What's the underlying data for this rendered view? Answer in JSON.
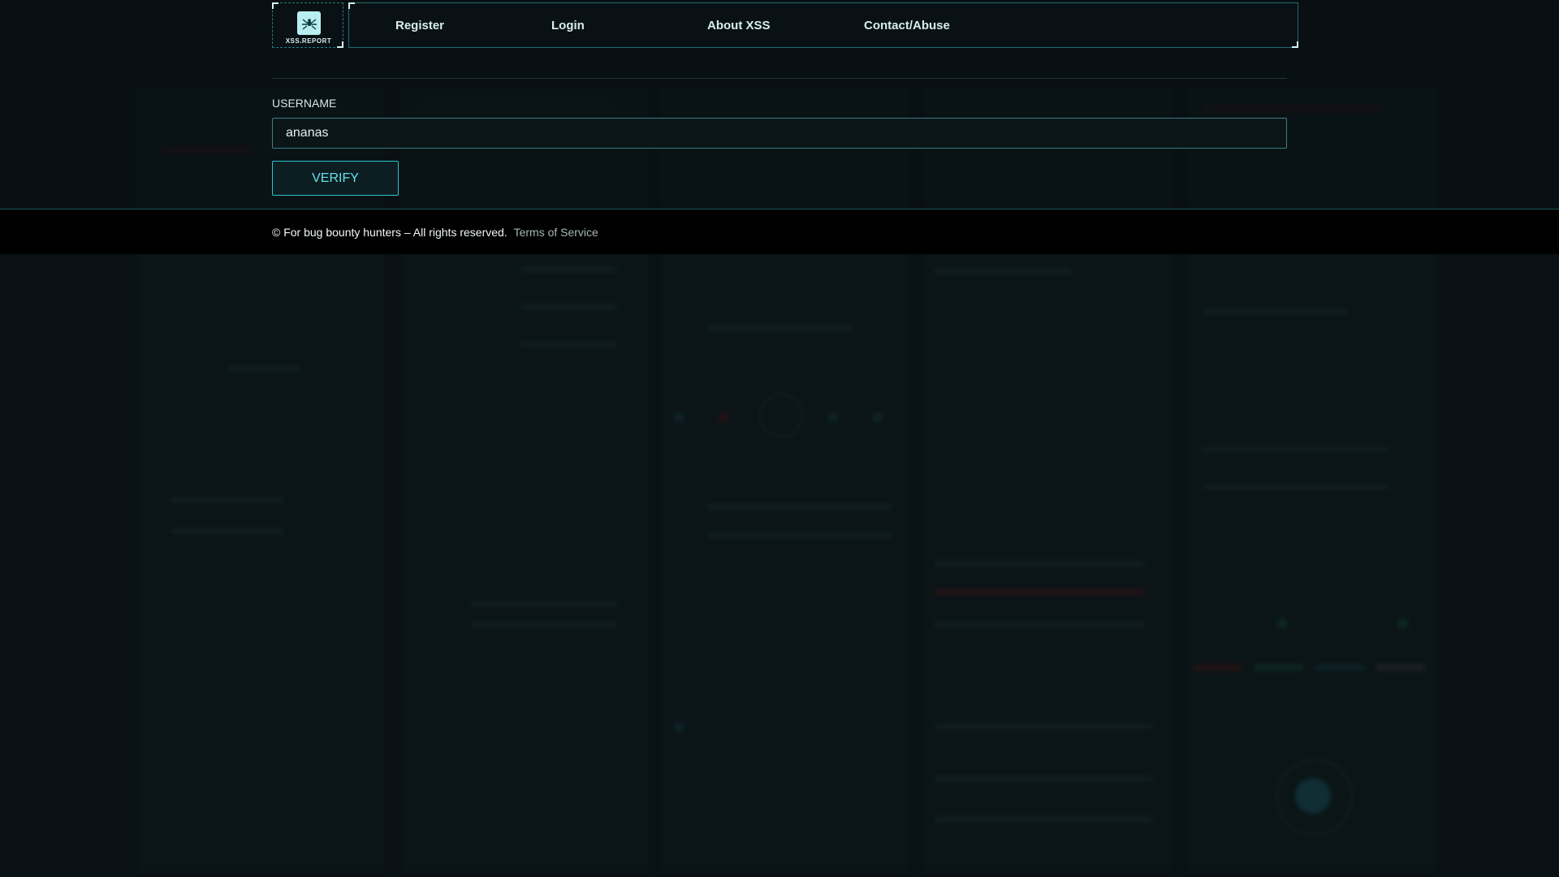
{
  "logo": {
    "text": "XSS.REPORT",
    "icon": "spider-logo-icon"
  },
  "nav": {
    "items": [
      {
        "label": "Register"
      },
      {
        "label": "Login"
      },
      {
        "label": "About XSS"
      },
      {
        "label": "Contact/Abuse"
      }
    ]
  },
  "form": {
    "username_label": "USERNAME",
    "username_value": "ananas",
    "verify_label": "VERIFY"
  },
  "footer": {
    "copyright": "© For bug bounty hunters – All rights reserved.",
    "terms_link": "Terms of Service"
  },
  "colors": {
    "background": "#0a1114",
    "accent": "#2ec4cf",
    "footer": "#000000"
  }
}
